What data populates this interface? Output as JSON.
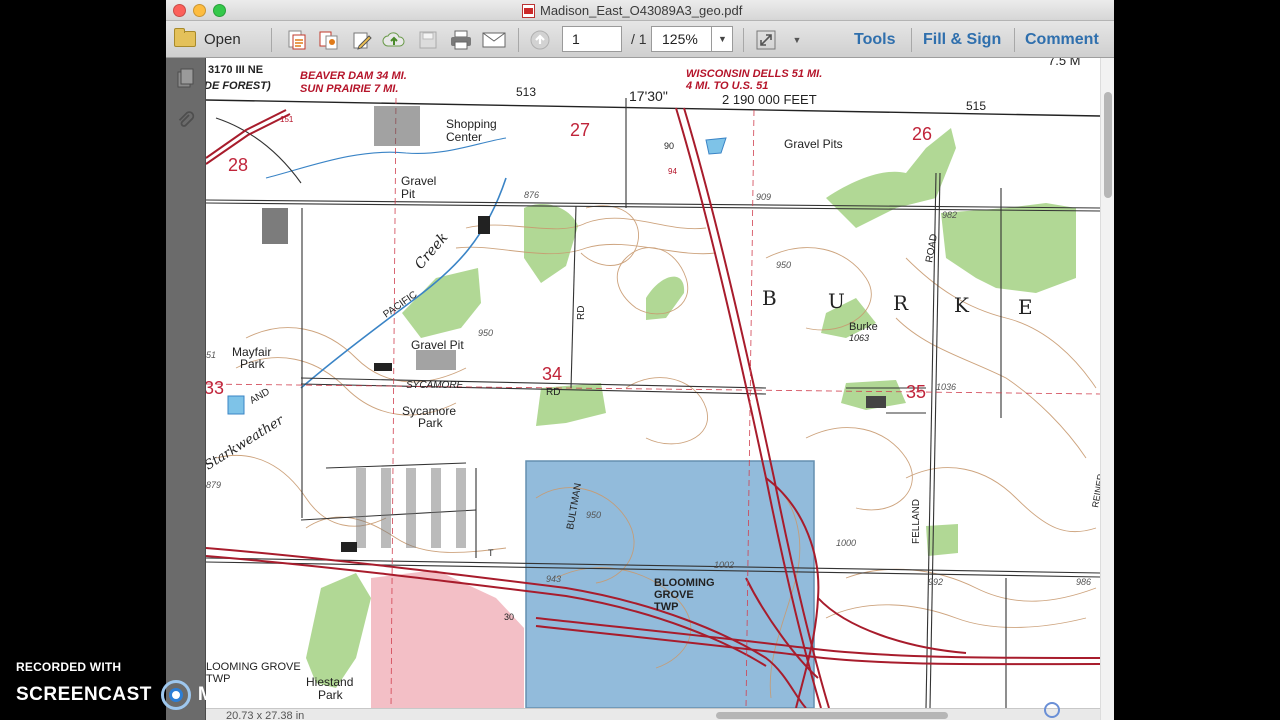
{
  "window": {
    "title": "Madison_East_O43089A3_geo.pdf",
    "traffic_colors": {
      "close": "#fc605b",
      "minimize": "#fdbc40",
      "zoom": "#34c84a"
    }
  },
  "toolbar": {
    "open_label": "Open",
    "page_current": "1",
    "page_total": "/ 1",
    "zoom_value": "125%",
    "tools_label": "Tools",
    "fill_sign_label": "Fill & Sign",
    "comment_label": "Comment",
    "link_color": "#2f6fad"
  },
  "statusbar": {
    "dimensions": "20.73 x 27.38 in"
  },
  "watermark": {
    "line1": "RECORDED WITH",
    "brand_left": "SCREENCAST",
    "brand_right": "MATIC"
  },
  "map": {
    "corner_labels": {
      "top_left_road": "3170 III NE",
      "top_left_place": "DE FOREST)",
      "beaver_dam": "BEAVER DAM 34 MI.",
      "sun_prairie": "SUN PRAIRIE 7 MI.",
      "wisconsin_dells": "WISCONSIN DELLS 51 MI.",
      "to_us51": "4 MI. TO U.S. 51",
      "top_right_scale": "7.5 M"
    },
    "grid_labels": {
      "tick_513": "513",
      "tick_515": "515",
      "minute": "17'30\"",
      "feet": "2 190 000 FEET"
    },
    "section_numbers": [
      "28",
      "27",
      "26",
      "34",
      "35",
      "33"
    ],
    "places": {
      "shopping": "Shopping",
      "center": "Center",
      "gravel_pit_1a": "Gravel",
      "gravel_pit_1b": "Pit",
      "gravel_pits": "Gravel Pits",
      "gravel_pit_2": "Gravel Pit",
      "pacific": "PACIFIC",
      "creek": "Creek",
      "mayfair": "Mayfair",
      "park": "Park",
      "sycamore": "SYCAMORE",
      "sycamore_park_1": "Sycamore",
      "sycamore_park_2": "Park",
      "starkweather": "Starkweather",
      "burke_letters": [
        "B",
        "U",
        "R",
        "K",
        "E"
      ],
      "burke_point": "Burke",
      "burke_elev": "1063",
      "bultman": "BULTMAN",
      "blooming_1": "BLOOMING",
      "blooming_2": "GROVE",
      "blooming_3": "TWP",
      "blooming_grove_left": "LOOMING GROVE",
      "twp_left": "TWP",
      "hiestand_1": "Hiestand",
      "hiestand_2": "Park",
      "felland": "FELLAND",
      "road": "ROAD",
      "rd1": "RD",
      "rd2": "RD",
      "and": "AND",
      "reiner": "REINER",
      "route_90": "90",
      "route_94": "94",
      "route_151": "151",
      "route_30": "30",
      "route_t": "T"
    },
    "elevations": [
      "876",
      "909",
      "950",
      "950",
      "982",
      "1036",
      "1000",
      "1002",
      "943",
      "992",
      "986",
      "879",
      "950",
      "51"
    ]
  }
}
